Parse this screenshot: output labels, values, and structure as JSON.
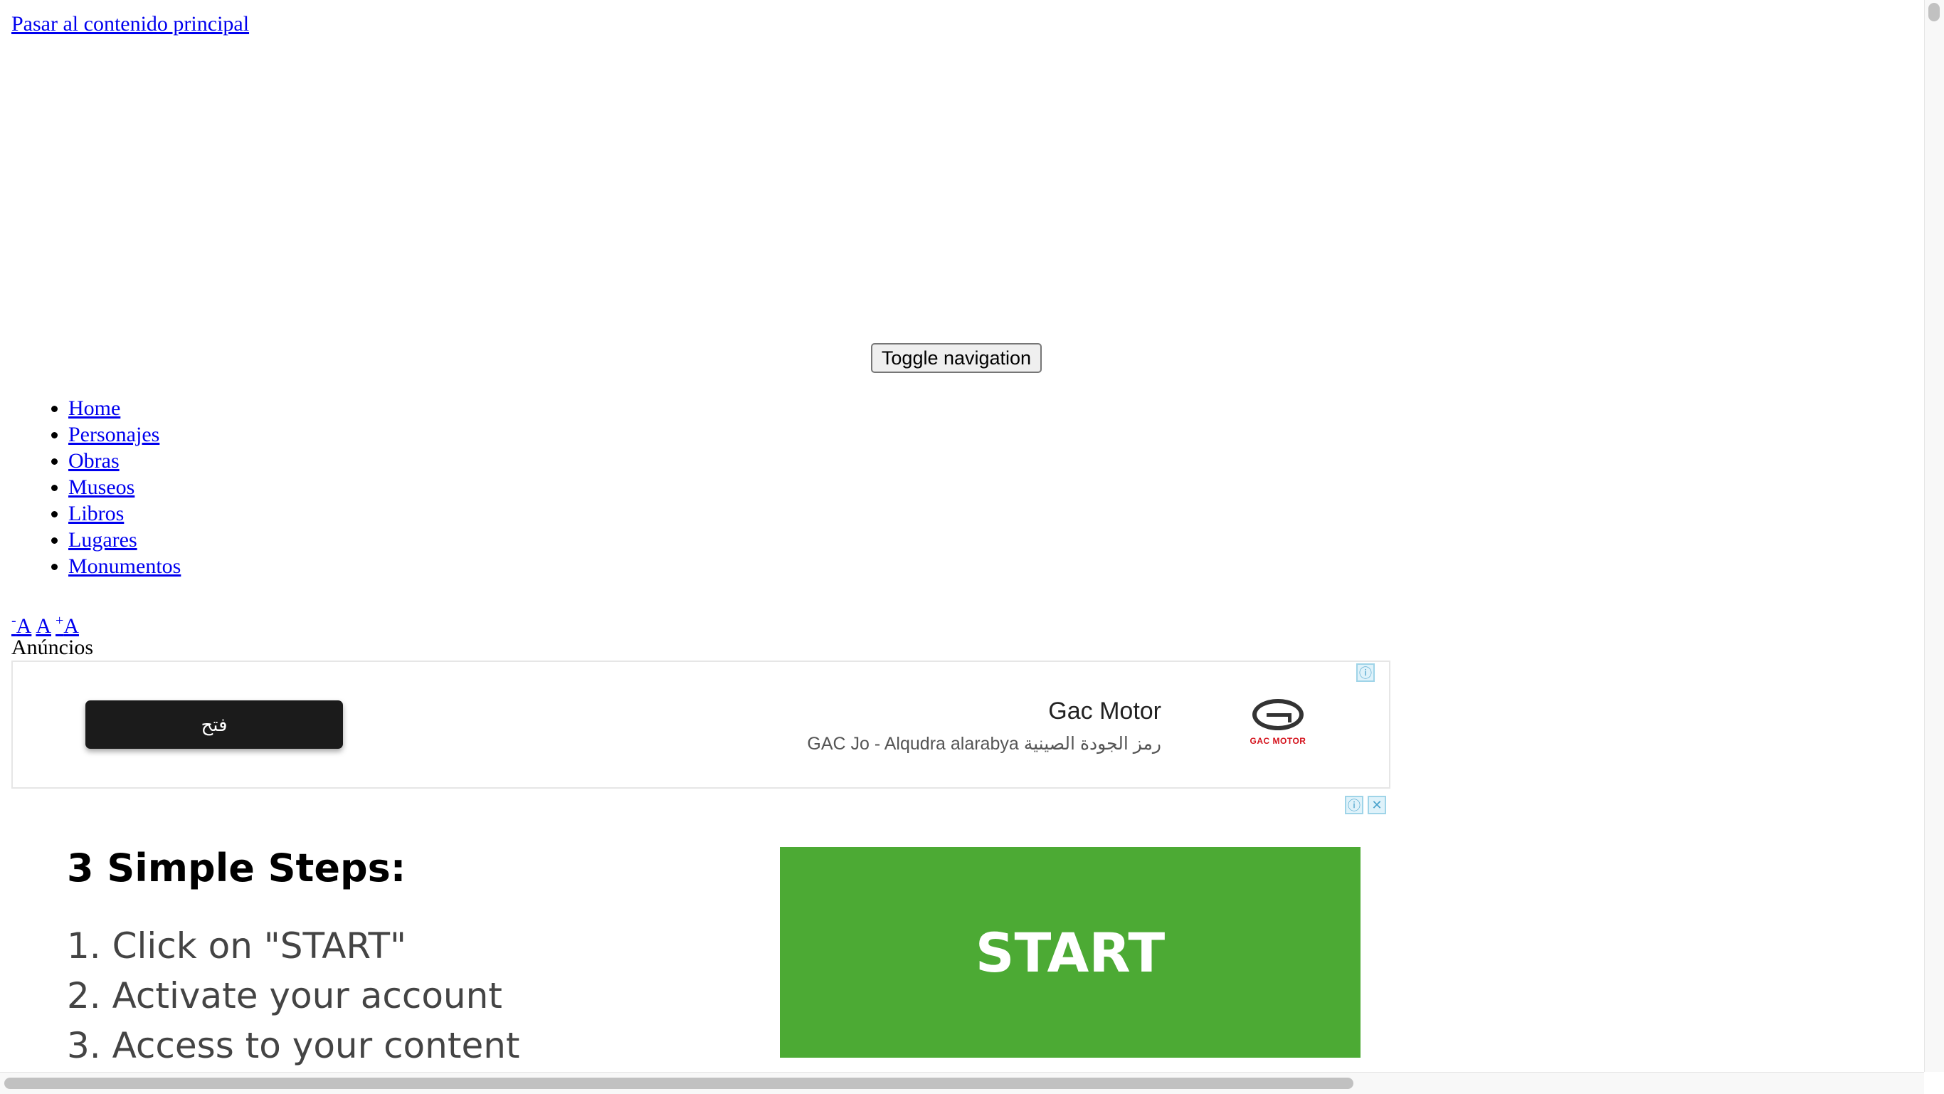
{
  "skip_link": "Pasar al contenido principal",
  "toggle_nav": "Toggle navigation",
  "nav": {
    "items": [
      "Home",
      "Personajes",
      "Obras",
      "Museos",
      "Libros",
      "Lugares",
      "Monumentos"
    ]
  },
  "font_controls": {
    "decrease_sup": "-",
    "decrease": "A",
    "normal": "A",
    "increase_sup": "+",
    "increase": "A"
  },
  "ads_label": "Anúncios",
  "ad1": {
    "button": "فتح",
    "title": "Gac Motor",
    "description": "GAC Jo - Alqudra alarabya رمز الجودة الصينية",
    "logo_text": "GAC MOTOR",
    "info_icon": "info-icon"
  },
  "ad2": {
    "heading": "3 Simple Steps:",
    "steps": [
      "1. Click on \"START\"",
      "2. Activate your account",
      "3. Access to your content"
    ],
    "start": "START",
    "info_icon": "info-icon",
    "close_icon": "close-icon"
  },
  "colors": {
    "link": "#0000ee",
    "start_green": "#4caa34",
    "ad_button_dark": "#1b1b1b",
    "brand_red": "#d4121c"
  }
}
